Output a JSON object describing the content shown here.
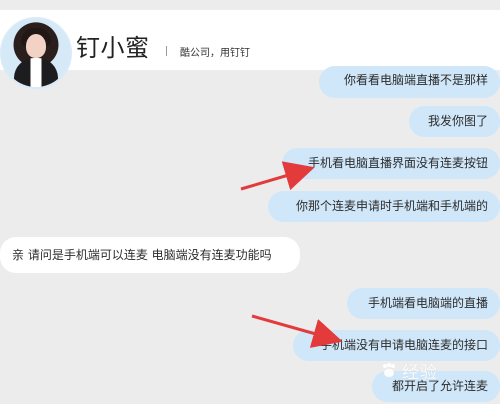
{
  "header": {
    "title": "钉小蜜",
    "subtitle": "酷公司，用钉钉"
  },
  "messages": [
    {
      "side": "right",
      "text": "你看看电脑端直播不是那样"
    },
    {
      "side": "right",
      "text": "我发你图了"
    },
    {
      "side": "right",
      "text": "手机看电脑直播界面没有连麦按钮"
    },
    {
      "side": "right",
      "text": "你那个连麦申请时手机端和手机端的"
    },
    {
      "side": "left",
      "text": "亲 请问是手机端可以连麦 电脑端没有连麦功能吗"
    },
    {
      "side": "right",
      "text": "手机端看电脑端的直播"
    },
    {
      "side": "right",
      "text": "手机端没有申请电脑连麦的接口"
    },
    {
      "side": "right",
      "text": "都开启了允许连麦"
    }
  ],
  "watermark": {
    "text": "经验"
  },
  "colors": {
    "background": "#ececec",
    "right_bubble": "#cfe7f9",
    "left_bubble": "#ffffff",
    "arrow": "#e33b3b"
  }
}
